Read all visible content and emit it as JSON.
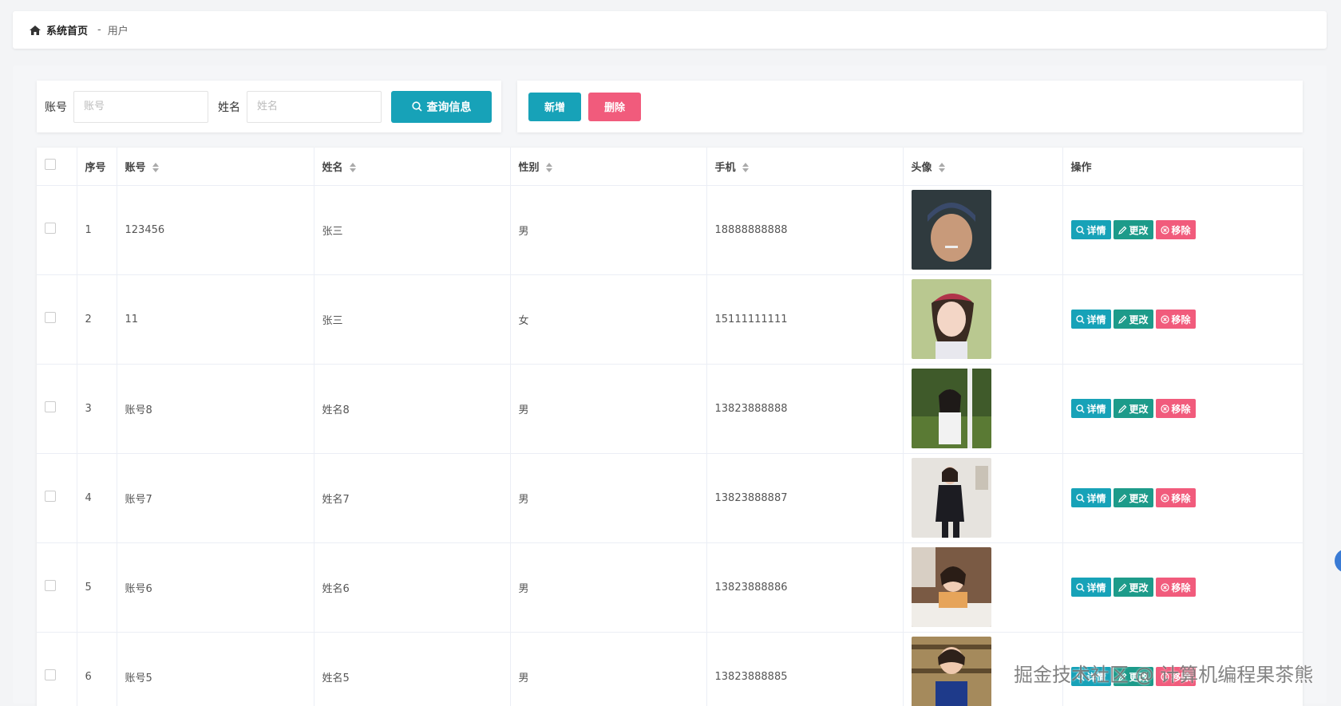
{
  "breadcrumb": {
    "home": "系统首页",
    "separator": "-",
    "current": "用户"
  },
  "search": {
    "account_label": "账号",
    "account_placeholder": "账号",
    "account_value": "",
    "name_label": "姓名",
    "name_placeholder": "姓名",
    "name_value": "",
    "search_button": "查询信息"
  },
  "actions": {
    "add": "新增",
    "delete": "删除"
  },
  "table": {
    "headers": {
      "index": "序号",
      "account": "账号",
      "name": "姓名",
      "gender": "性别",
      "phone": "手机",
      "avatar": "头像",
      "ops": "操作"
    },
    "op_labels": {
      "detail": "详情",
      "edit": "更改",
      "remove": "移除"
    },
    "rows": [
      {
        "index": "1",
        "account": "123456",
        "name": "张三",
        "gender": "男",
        "phone": "18888888888",
        "avatar": "avatar-male-cap"
      },
      {
        "index": "2",
        "account": "11",
        "name": "张三",
        "gender": "女",
        "phone": "15111111111",
        "avatar": "avatar-girl-beret"
      },
      {
        "index": "3",
        "account": "账号8",
        "name": "姓名8",
        "gender": "男",
        "phone": "13823888888",
        "avatar": "avatar-girl-outdoor"
      },
      {
        "index": "4",
        "account": "账号7",
        "name": "姓名7",
        "gender": "男",
        "phone": "13823888887",
        "avatar": "avatar-woman-suit"
      },
      {
        "index": "5",
        "account": "账号6",
        "name": "姓名6",
        "gender": "男",
        "phone": "13823888886",
        "avatar": "avatar-girl-library"
      },
      {
        "index": "6",
        "account": "账号5",
        "name": "姓名5",
        "gender": "男",
        "phone": "13823888885",
        "avatar": "avatar-woman-bookshelf"
      }
    ]
  },
  "watermark": "掘金技术社区 @ 计算机编程果茶熊",
  "colors": {
    "primary": "#17a2b8",
    "edit": "#1d9b8a",
    "danger": "#f15b7c"
  }
}
